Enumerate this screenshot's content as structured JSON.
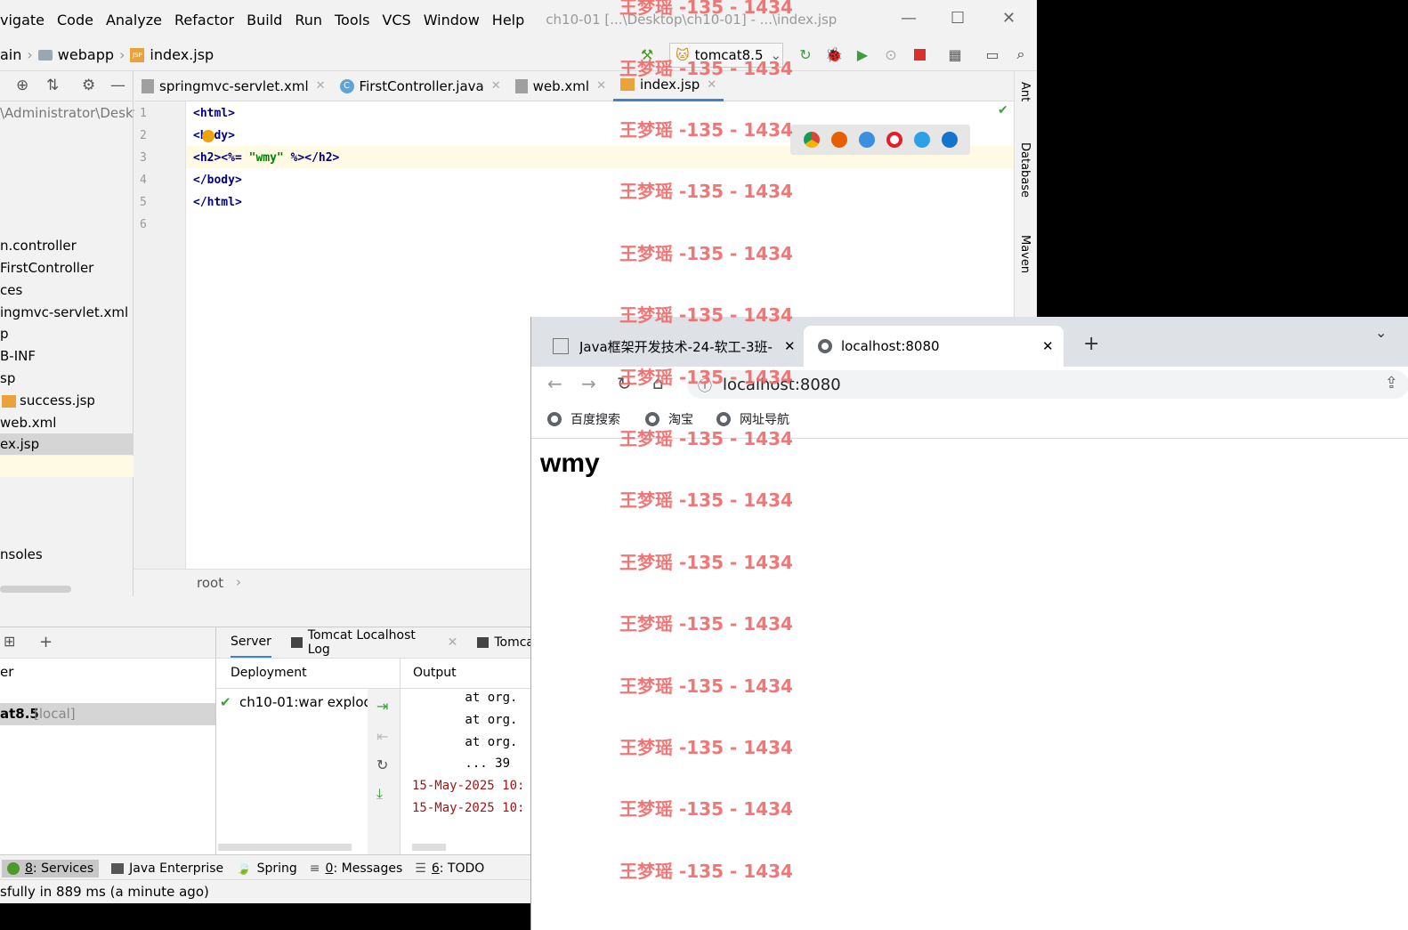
{
  "ide": {
    "menu": [
      "vigate",
      "Code",
      "Analyze",
      "Refactor",
      "Build",
      "Run",
      "Tools",
      "VCS",
      "Window",
      "Help"
    ],
    "title": "ch10-01 [...\\Desktop\\ch10-01] - ...\\index.jsp",
    "breadcrumbs": [
      "ain",
      "webapp",
      "index.jsp"
    ],
    "run_config": "tomcat8.5",
    "project_path": "\\Administrator\\Deskt",
    "project_items": [
      {
        "label": "n.controller"
      },
      {
        "label": "FirstController"
      },
      {
        "label": "ces"
      },
      {
        "label": "ingmvc-servlet.xml"
      },
      {
        "label": "p"
      },
      {
        "label": "B-INF"
      },
      {
        "label": "sp"
      },
      {
        "label": "success.jsp"
      },
      {
        "label": "web.xml"
      },
      {
        "label": "ex.jsp"
      },
      {
        "label": "nsoles"
      }
    ],
    "editor_tabs": [
      {
        "label": "springmvc-servlet.xml"
      },
      {
        "label": "FirstController.java"
      },
      {
        "label": "web.xml"
      },
      {
        "label": "index.jsp"
      }
    ],
    "line_numbers": [
      "1",
      "2",
      "3",
      "4",
      "5",
      "6"
    ],
    "code_lines": [
      "<html>",
      "<body>",
      "<h2><%= \"wmy\" %></h2>",
      "</body>",
      "</html>"
    ],
    "breadcrumb_bottom": "root",
    "right_strip": [
      "Ant",
      "Database",
      "Maven"
    ],
    "services": {
      "left_items": [
        "er",
        "at8.5"
      ],
      "local_tag": "[local]",
      "tabs": [
        "Server",
        "Tomcat Localhost Log",
        "Tomca"
      ],
      "deployment_header": "Deployment",
      "output_header": "Output",
      "deployment_item": "ch10-01:war explod",
      "output_lines": [
        "        at org.",
        "        at org.",
        "        at org.",
        "        ... 39",
        "15-May-2025 10:",
        "15-May-2025 10:"
      ]
    },
    "bottom_tabs": [
      {
        "num": "8",
        "label": ": Services"
      },
      {
        "num": "",
        "label": "Java Enterprise"
      },
      {
        "num": "",
        "label": "Spring"
      },
      {
        "num": "0",
        "label": ": Messages"
      },
      {
        "num": "6",
        "label": ": TODO"
      }
    ],
    "status": "sfully in 889 ms (a minute ago)"
  },
  "chrome": {
    "tabs": [
      {
        "label": "Java框架开发技术-24-软工-3班-"
      },
      {
        "label": "localhost:8080"
      }
    ],
    "url": "localhost:8080",
    "bookmarks": [
      "百度搜索",
      "淘宝",
      "网址导航"
    ],
    "page_heading": "wmy"
  },
  "watermark": "王梦瑶 -135 - 1434"
}
